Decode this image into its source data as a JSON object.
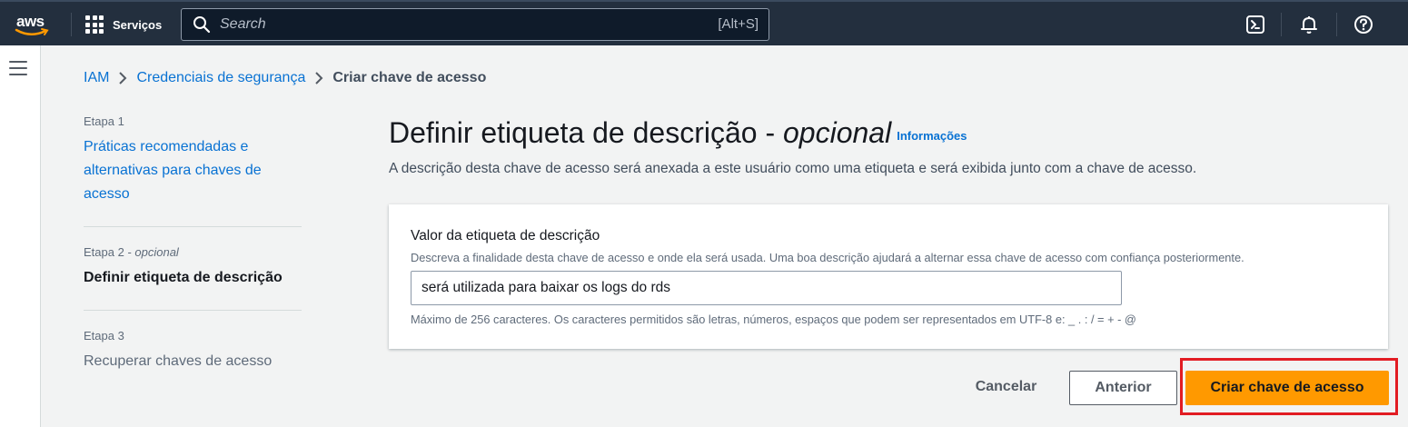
{
  "topnav": {
    "logo_text": "aws",
    "services_label": "Serviços",
    "search_placeholder": "Search",
    "search_shortcut": "[Alt+S]",
    "icons": [
      "cloudshell-icon",
      "bell-icon",
      "help-icon"
    ]
  },
  "breadcrumb": {
    "items": [
      "IAM",
      "Credenciais de segurança"
    ],
    "current": "Criar chave de acesso"
  },
  "steps": [
    {
      "number": "Etapa 1",
      "optional": "",
      "label_lines": [
        "Práticas recomendadas e",
        "alternativas para chaves de",
        "acesso"
      ],
      "state": "link"
    },
    {
      "number": "Etapa 2",
      "optional": "opcional",
      "label": "Definir etiqueta de descrição",
      "state": "active"
    },
    {
      "number": "Etapa 3",
      "optional": "",
      "label": "Recuperar chaves de acesso",
      "state": "disabled"
    }
  ],
  "main": {
    "title": "Definir etiqueta de descrição - ",
    "title_optional": "opcional",
    "info_link": "Informações",
    "description": "A descrição desta chave de acesso será anexada a este usuário como uma etiqueta e será exibida junto com a chave de acesso."
  },
  "form": {
    "label": "Valor da etiqueta de descrição",
    "help": "Descreva a finalidade desta chave de acesso e onde ela será usada. Uma boa descrição ajudará a alternar essa chave de acesso com confiança posteriormente.",
    "value": "será utilizada para baixar os logs do rds",
    "constraint": "Máximo de 256 caracteres. Os caracteres permitidos são letras, números, espaços que podem ser representados em UTF-8 e: _ . : / = + - @"
  },
  "actions": {
    "cancel": "Cancelar",
    "previous": "Anterior",
    "create": "Criar chave de acesso"
  },
  "colors": {
    "nav_bg": "#232f3e",
    "link": "#0972d3",
    "primary_button": "#ff9900",
    "highlight": "#e21c23"
  }
}
